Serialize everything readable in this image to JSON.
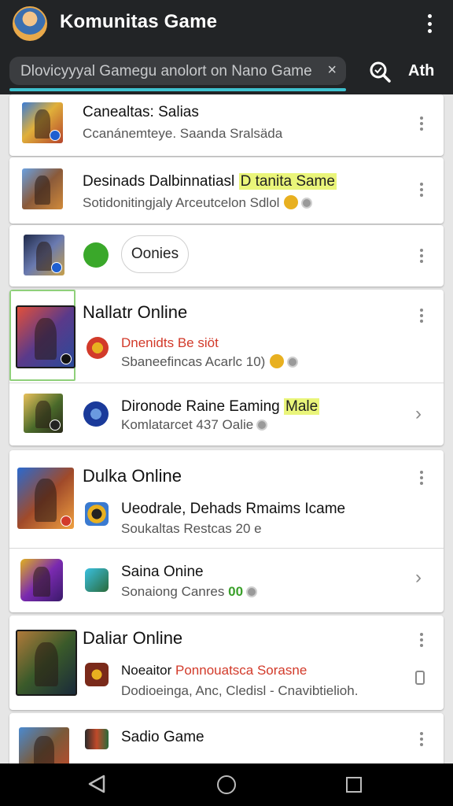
{
  "app": {
    "title": "Komunitas Game"
  },
  "search": {
    "value": "Dlovicyyyal Gamegu anolort on Nano Game",
    "clear": "×",
    "action_label": "Ath"
  },
  "items": [
    {
      "title": "Canealtas: Salias",
      "subtitle": "Ccanánemteye. Saanda Sralsäda"
    },
    {
      "title": "Desinads Dalbinnatiasl",
      "title_highlight": "D tanita Same",
      "subtitle": "Sotidonitingjaly Arceutcelon Sdlol"
    },
    {
      "chip": "Oonies"
    },
    {
      "title": "Nallatr Online",
      "red_text": "Dnenidts Be siöt",
      "subtitle": "Sbaneefincas Acarlc 10)"
    },
    {
      "title": "Dironode Raine Eaming",
      "title_highlight": "Male",
      "subtitle": "Komlatarcet 437 Oalie"
    },
    {
      "title": "Dulka Online",
      "line2": "Ueodrale, Dehads Rmaims Icame",
      "subtitle": "Soukaltas Restcas 20 e"
    },
    {
      "title": "Saina Onine",
      "subtitle": "Sonaiong Canres",
      "green": "00"
    },
    {
      "title": "Daliar Online",
      "line2_prefix": "Noeaitor",
      "line2_red": "Ponnouatsca Sorasne",
      "subtitle": "Dodioeinga, Anc, Cledisl - Cnavibtielioh."
    },
    {
      "title": "Sadio Game"
    }
  ],
  "colors": {
    "appbar": "#222426",
    "accent": "#3ec1cf",
    "background": "#e6e6e6"
  },
  "icons": [
    "more-vert-icon",
    "search-icon",
    "close-icon",
    "chevron-right-icon",
    "back-icon",
    "home-icon",
    "recents-icon"
  ]
}
